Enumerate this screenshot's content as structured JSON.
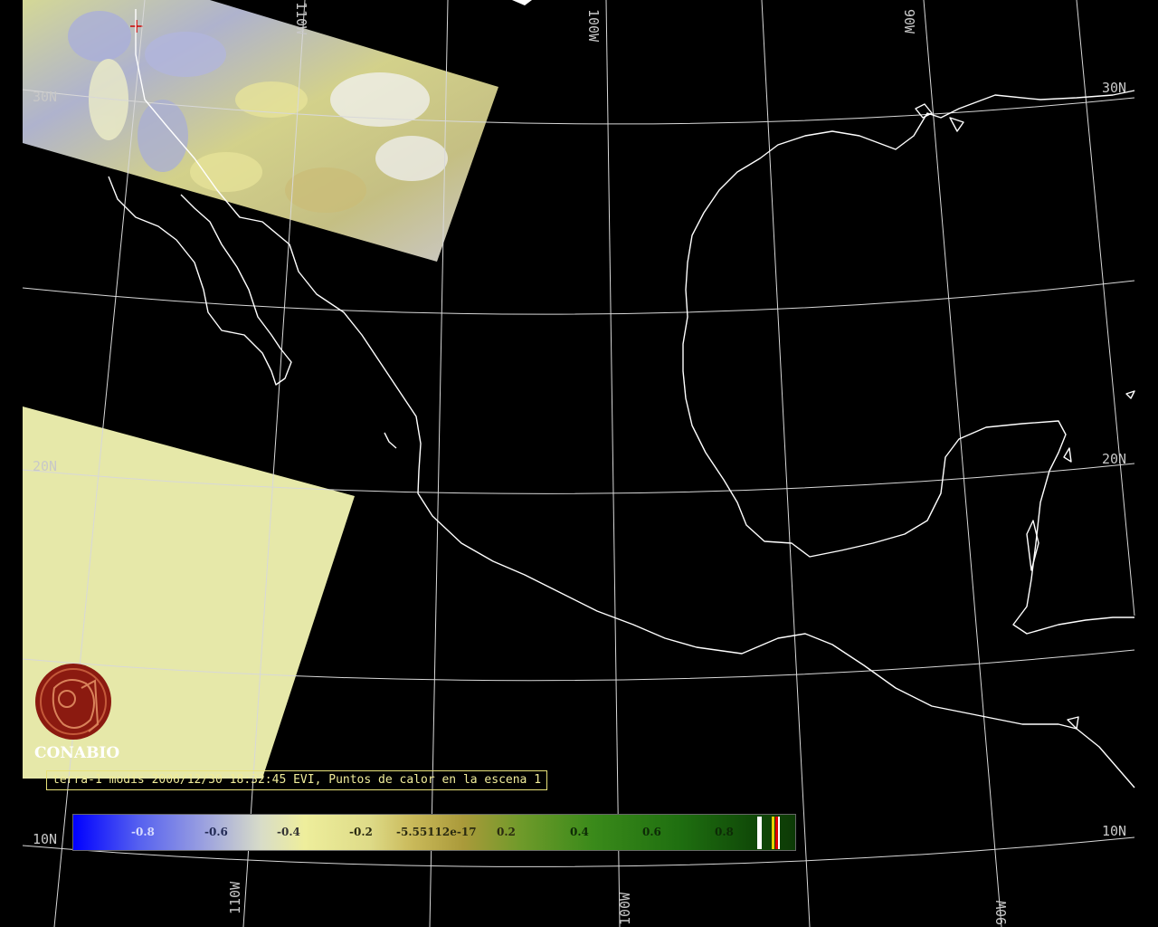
{
  "caption": "terra-1 modis 2006/12/30 18:32:45 EVI, Puntos de calor en la escena 1",
  "logo": {
    "text": "CONABIO",
    "icon": "conabio-logo-icon",
    "color": "#8b1a10"
  },
  "grid_labels": {
    "lat_30_left": "30N",
    "lat_20_left": "20N",
    "lat_10_left": "10N",
    "lat_30_right": "30N",
    "lat_20_right": "20N",
    "lat_10_right": "10N",
    "lon_110_top": "110W",
    "lon_100_top": "100W",
    "lon_90_top": "90W",
    "lon_110_bottom": "110W",
    "lon_100_bottom": "100W",
    "lon_90_bottom": "90W"
  },
  "colorbar": {
    "ticks": [
      "-0.8",
      "-0.6",
      "-0.4",
      "-0.2",
      "-5.55112e-17",
      "0.2",
      "0.4",
      "0.6",
      "0.8"
    ]
  },
  "colors": {
    "background": "#000000",
    "grid": "#d8d8d8",
    "coastline": "#ffffff",
    "swath_fill": "#e8e8a8",
    "caption_text": "#f0ec9a"
  }
}
